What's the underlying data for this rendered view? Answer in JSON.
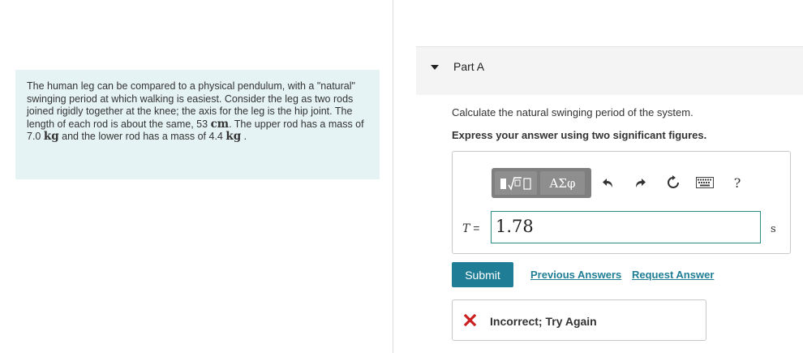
{
  "problem": {
    "text_1": "The human leg can be compared to a physical pendulum, with a \"natural\" swinging period at which walking is easiest. Consider the leg as two rods joined rigidly together at the knee; the axis for the leg is the hip joint. The length of each rod is about the same, 53",
    "unit_cm": "cm",
    "text_2": ". The upper rod has a mass of 7.0",
    "unit_kg_1": "kg",
    "text_3": "and the lower rod has a mass of 4.4",
    "unit_kg_2": "kg",
    "text_4": "."
  },
  "part": {
    "title": "Part A",
    "question": "Calculate the natural swinging period of the system.",
    "instruction": "Express your answer using two significant figures."
  },
  "toolbar": {
    "greek_label": "ΑΣφ",
    "help_label": "?",
    "icons": [
      "templates-icon",
      "greek-icon",
      "undo-icon",
      "redo-icon",
      "reset-icon",
      "keyboard-icon",
      "help-icon"
    ]
  },
  "answer": {
    "variable": "T",
    "equals": "=",
    "value": "1.78",
    "unit": "s"
  },
  "actions": {
    "submit_label": "Submit",
    "previous_answers_label": "Previous Answers",
    "request_answer_label": "Request Answer"
  },
  "feedback": {
    "text": "Incorrect; Try Again",
    "status_color": "#cc1f1f"
  },
  "colors": {
    "accent": "#1f7e95",
    "problem_bg": "#e6f3f4",
    "input_border": "#2f8a8a"
  }
}
